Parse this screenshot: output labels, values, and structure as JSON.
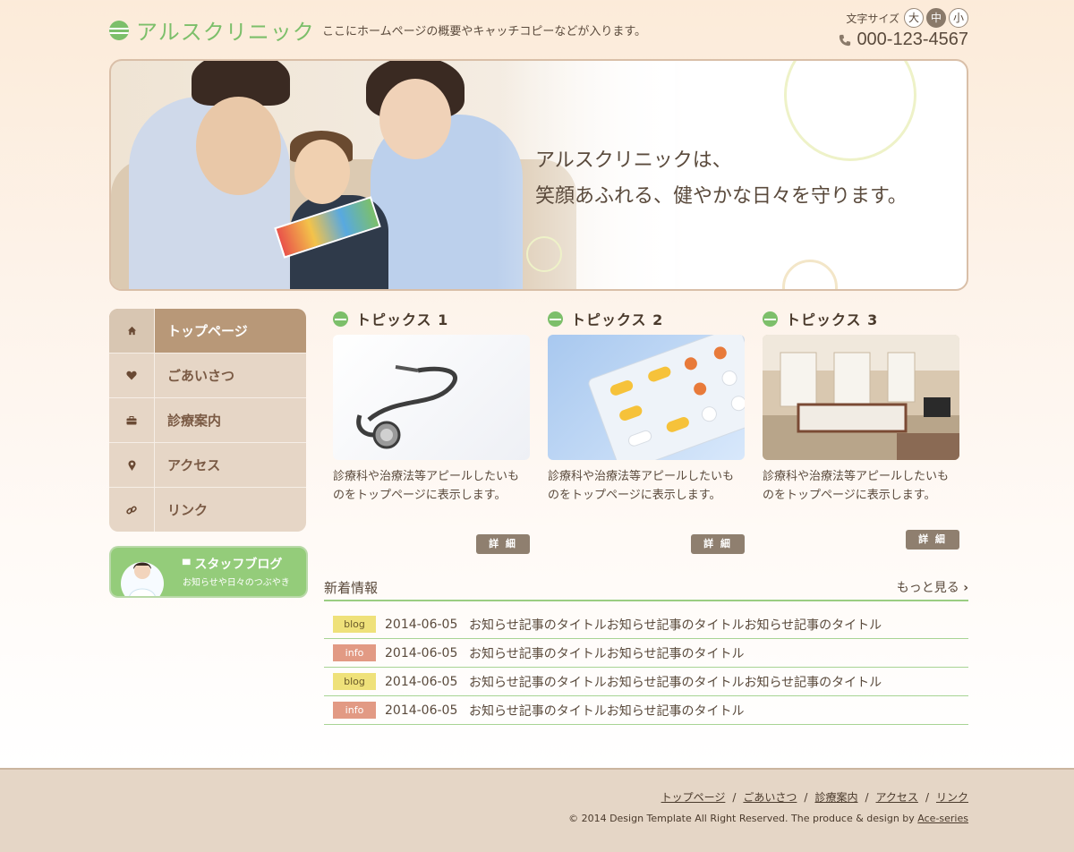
{
  "header": {
    "logo_text": "アルスクリニック",
    "catch_copy": "ここにホームページの概要やキャッチコピーなどが入ります。",
    "font_size_label": "文字サイズ",
    "font_sizes": [
      "大",
      "中",
      "小"
    ],
    "phone": "000-123-4567"
  },
  "hero": {
    "line1": "アルスクリニックは、",
    "line2": "笑顔あふれる、健やかな日々を守ります。"
  },
  "nav": [
    {
      "label": "トップページ",
      "icon": "home-icon"
    },
    {
      "label": "ごあいさつ",
      "icon": "heart-icon"
    },
    {
      "label": "診療案内",
      "icon": "briefcase-icon"
    },
    {
      "label": "アクセス",
      "icon": "map-pin-icon"
    },
    {
      "label": "リンク",
      "icon": "link-icon"
    }
  ],
  "blog_banner": {
    "title": "スタッフブログ",
    "subtitle": "お知らせや日々のつぶやき"
  },
  "topics": [
    {
      "title": "トピックス 1",
      "text": "診療科や治療法等アピールしたいものをトップページに表示します。",
      "button": "詳 細"
    },
    {
      "title": "トピックス 2",
      "text": "診療科や治療法等アピールしたいものをトップページに表示します。",
      "button": "詳 細"
    },
    {
      "title": "トピックス 3",
      "text": "診療科や治療法等アピールしたいものをトップページに表示します。",
      "button": "詳 細"
    }
  ],
  "news": {
    "heading": "新着情報",
    "more": "もっと見る",
    "items": [
      {
        "tag": "blog",
        "date": "2014-06-05",
        "title": "お知らせ記事のタイトルお知らせ記事のタイトルお知らせ記事のタイトル"
      },
      {
        "tag": "info",
        "date": "2014-06-05",
        "title": "お知らせ記事のタイトルお知らせ記事のタイトル"
      },
      {
        "tag": "blog",
        "date": "2014-06-05",
        "title": "お知らせ記事のタイトルお知らせ記事のタイトルお知らせ記事のタイトル"
      },
      {
        "tag": "info",
        "date": "2014-06-05",
        "title": "お知らせ記事のタイトルお知らせ記事のタイトル"
      }
    ]
  },
  "footer": {
    "links": [
      "トップページ",
      "ごあいさつ",
      "診療案内",
      "アクセス",
      "リンク"
    ],
    "copyright": "© 2014 Design Template All Right Reserved. The produce & design by",
    "credit": "Ace-series"
  },
  "colors": {
    "accent_green": "#7cbf6a",
    "nav_active": "#b89878",
    "nav_bg": "#e6d6c6",
    "tag_blog": "#efe17a",
    "tag_info": "#e29a84"
  }
}
